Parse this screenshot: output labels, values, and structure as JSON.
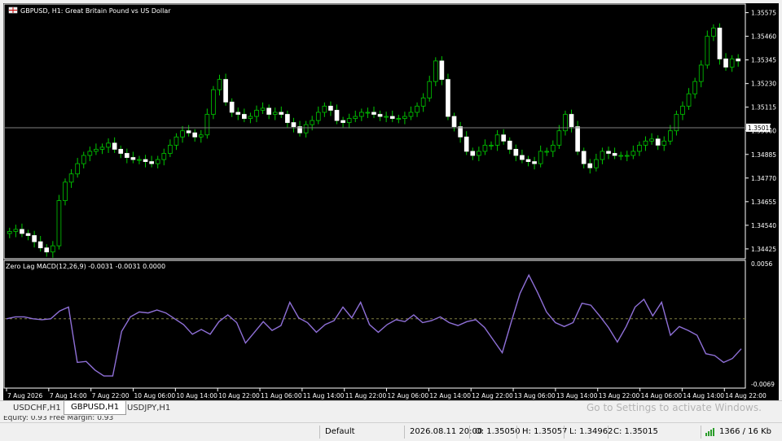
{
  "chart": {
    "title": "GBPUSD, H1:  Great Britain Pound vs US Dollar",
    "current_price": "1.35015",
    "price_labels": [
      "1.35575",
      "1.35460",
      "1.35345",
      "1.35230",
      "1.35115",
      "1.35000",
      "1.34885",
      "1.34770",
      "1.34655",
      "1.34540",
      "1.34425"
    ],
    "time_labels": [
      "7 Aug 2026",
      "7 Aug 14:00",
      "7 Aug 22:00",
      "10 Aug 06:00",
      "10 Aug 14:00",
      "10 Aug 22:00",
      "11 Aug 06:00",
      "11 Aug 14:00",
      "11 Aug 22:00",
      "12 Aug 06:00",
      "12 Aug 14:00",
      "12 Aug 22:00",
      "13 Aug 06:00",
      "13 Aug 14:00",
      "13 Aug 22:00",
      "14 Aug 06:00",
      "14 Aug 14:00",
      "14 Aug 22:00"
    ],
    "indicator": {
      "label": "Zero Lag MACD(12,26,9) -0.0031 -0.0031 0.0000",
      "scale_max": "0.0056",
      "scale_min": "-0.0069"
    },
    "colors": {
      "background": "#000000",
      "bull_candle": "#ffffff",
      "wick": "#00c800",
      "bid_line": "#808080",
      "macd_line": "#8080ff",
      "macd_line_2": "#c060c0",
      "zero_line": "#808040"
    }
  },
  "tabs": [
    {
      "label": "USDCHF,H1",
      "active": false
    },
    {
      "label": "GBPUSD,H1",
      "active": true
    },
    {
      "label": "USDJPY,H1",
      "active": false
    }
  ],
  "watermark": "Go to Settings to activate Windows.",
  "account_line": "Equity: 0.93  Free Margin: 0.93",
  "status": {
    "profile": "Default",
    "datetime": "2026.08.11 20:00",
    "open": "O: 1.35050",
    "high": "H: 1.35057",
    "low": "L: 1.34962",
    "close": "C: 1.35015",
    "traffic": "1366 / 16 Kb"
  },
  "chart_data": {
    "type": "candlestick",
    "symbol": "GBPUSD",
    "timeframe": "H1",
    "ylim": [
      1.34385,
      1.35605
    ],
    "close_series": [
      1.3451,
      1.3452,
      1.345,
      1.3449,
      1.3446,
      1.3443,
      1.3441,
      1.3444,
      1.3466,
      1.3475,
      1.3479,
      1.3484,
      1.3488,
      1.349,
      1.3491,
      1.3492,
      1.3494,
      1.3491,
      1.3489,
      1.3487,
      1.3486,
      1.3486,
      1.3485,
      1.3484,
      1.3486,
      1.3489,
      1.3493,
      1.3497,
      1.35,
      1.3499,
      1.3497,
      1.3498,
      1.3508,
      1.352,
      1.3525,
      1.3514,
      1.3509,
      1.3508,
      1.3506,
      1.3507,
      1.351,
      1.3511,
      1.3508,
      1.3509,
      1.3508,
      1.3504,
      1.3502,
      1.3499,
      1.3503,
      1.3505,
      1.3509,
      1.3512,
      1.351,
      1.3505,
      1.3504,
      1.3506,
      1.3507,
      1.3509,
      1.3509,
      1.3508,
      1.3507,
      1.3507,
      1.3506,
      1.3506,
      1.3507,
      1.3509,
      1.3512,
      1.3516,
      1.3524,
      1.3534,
      1.3525,
      1.3507,
      1.3502,
      1.3497,
      1.349,
      1.3488,
      1.349,
      1.3493,
      1.3493,
      1.3498,
      1.3495,
      1.3491,
      1.3488,
      1.3486,
      1.3485,
      1.3484,
      1.349,
      1.349,
      1.3493,
      1.35,
      1.3508,
      1.3502,
      1.349,
      1.3484,
      1.3482,
      1.3486,
      1.349,
      1.3489,
      1.3488,
      1.3488,
      1.3488,
      1.349,
      1.3493,
      1.3495,
      1.3496,
      1.3493,
      1.3495,
      1.35,
      1.3508,
      1.3512,
      1.3518,
      1.3524,
      1.3532,
      1.3546,
      1.355,
      1.3535,
      1.3531,
      1.3535,
      1.3534
    ],
    "indicator_series": {
      "name": "Zero Lag MACD(12,26,9)",
      "ylim": [
        -0.0069,
        0.0056
      ],
      "values": [
        0.0,
        0.0002,
        0.0002,
        0.0,
        -0.0001,
        0.0,
        0.0008,
        0.0012,
        -0.0045,
        -0.0044,
        -0.0053,
        -0.0059,
        -0.0059,
        -0.0013,
        0.0002,
        0.0007,
        0.0006,
        0.0009,
        0.0006,
        0.0,
        -0.0006,
        -0.0016,
        -0.0011,
        -0.0016,
        -0.0003,
        0.0004,
        -0.0004,
        -0.0025,
        -0.0014,
        -0.0003,
        -0.0012,
        -0.0007,
        0.0017,
        0.0001,
        -0.0004,
        -0.0014,
        -0.0006,
        -0.0002,
        0.0012,
        0.0001,
        0.0017,
        -0.0006,
        -0.0014,
        -0.0006,
        -0.0001,
        -0.0003,
        0.0004,
        -0.0004,
        -0.0002,
        0.0002,
        -0.0004,
        -0.0007,
        -0.0003,
        -0.0001,
        -0.0009,
        -0.0022,
        -0.0035,
        -0.0004,
        0.0026,
        0.0045,
        0.0027,
        0.0007,
        -0.0004,
        -0.0008,
        -0.0004,
        0.0016,
        0.0014,
        0.0003,
        -0.0009,
        -0.0024,
        -0.0008,
        0.0012,
        0.002,
        0.0003,
        0.0017,
        -0.0017,
        -0.0008,
        -0.0012,
        -0.0017,
        -0.0036,
        -0.0038,
        -0.0045,
        -0.0041,
        -0.0031
      ]
    }
  }
}
